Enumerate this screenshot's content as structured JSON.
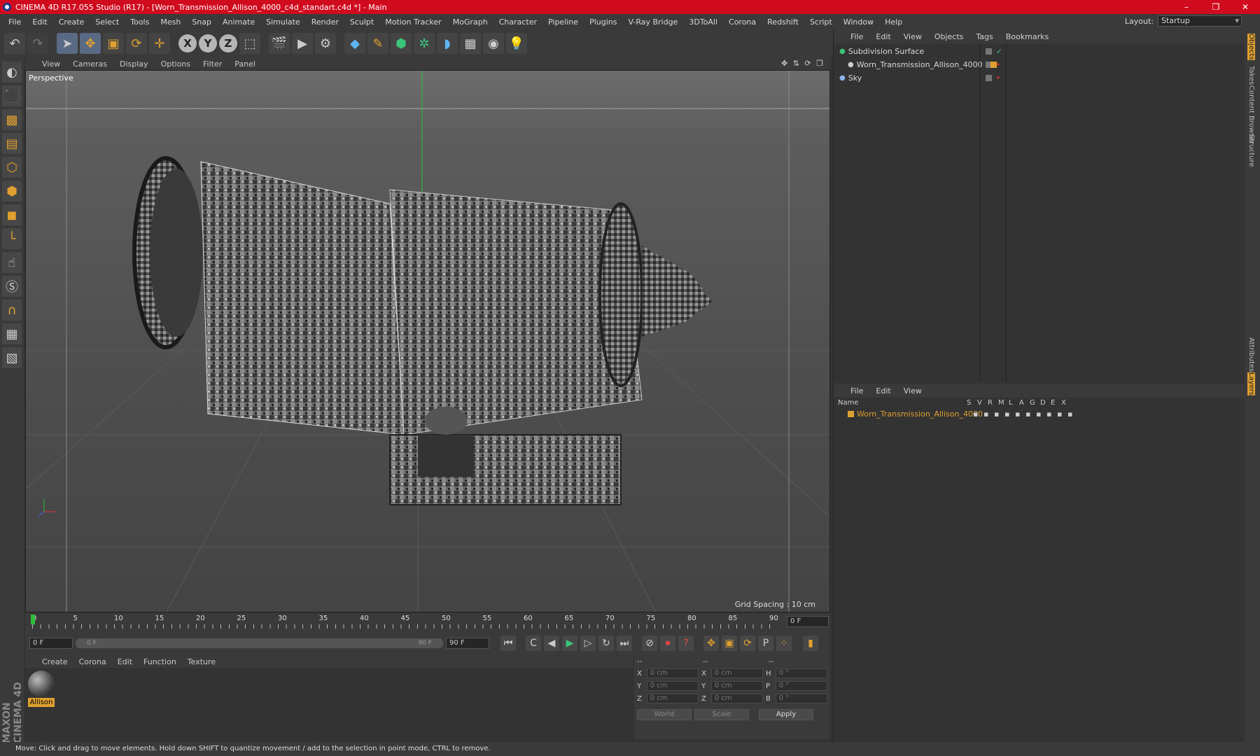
{
  "window": {
    "title": "CINEMA 4D R17.055 Studio (R17) - [Worn_Transmission_Allison_4000_c4d_standart.c4d *] - Main",
    "controls": [
      "–",
      "❐",
      "✕"
    ]
  },
  "menubar": [
    "File",
    "Edit",
    "Create",
    "Select",
    "Tools",
    "Mesh",
    "Snap",
    "Animate",
    "Simulate",
    "Render",
    "Sculpt",
    "Motion Tracker",
    "MoGraph",
    "Character",
    "Pipeline",
    "Plugins",
    "V-Ray Bridge",
    "3DToAll",
    "Corona",
    "Redshift",
    "Script",
    "Window",
    "Help"
  ],
  "layout": {
    "label": "Layout:",
    "value": "Startup"
  },
  "toolbar": {
    "axis_x": "X",
    "axis_y": "Y",
    "axis_z": "Z",
    "icons": [
      "undo-icon",
      "redo-icon",
      "select-icon",
      "move-icon",
      "scale-icon",
      "rotate-icon",
      "move-add-icon",
      "x-axis-icon",
      "y-axis-icon",
      "z-axis-icon",
      "coordinate-system-icon",
      "render-view-icon",
      "render-picture-viewer-icon",
      "edit-render-settings-icon",
      "cube-icon",
      "pen-icon",
      "subdivision-icon",
      "cloner-icon",
      "deformer-icon",
      "floor-icon",
      "camera-icon",
      "light-icon"
    ]
  },
  "viewport": {
    "menu": [
      "View",
      "Cameras",
      "Display",
      "Options",
      "Filter",
      "Panel"
    ],
    "label": "Perspective",
    "grid_spacing": "Grid Spacing : 10 cm"
  },
  "timeline": {
    "ticks": [
      "0",
      "5",
      "10",
      "15",
      "20",
      "25",
      "30",
      "35",
      "40",
      "45",
      "50",
      "55",
      "60",
      "65",
      "70",
      "75",
      "80",
      "85",
      "90"
    ],
    "current_frame": "0 F",
    "start_field": "0 F",
    "slider_start": "0 F",
    "slider_end": "90 F",
    "end_field": "90 F"
  },
  "material_manager": {
    "menu": [
      "Create",
      "Corona",
      "Edit",
      "Function",
      "Texture"
    ],
    "materials": [
      {
        "name": "Allison"
      }
    ]
  },
  "coordinates": {
    "header": [
      "--",
      "--",
      "--"
    ],
    "rows": [
      {
        "a": "X",
        "av": "0 cm",
        "b": "X",
        "bv": "0 cm",
        "c": "H",
        "cv": "0 °"
      },
      {
        "a": "Y",
        "av": "0 cm",
        "b": "Y",
        "bv": "0 cm",
        "c": "P",
        "cv": "0 °"
      },
      {
        "a": "Z",
        "av": "0 cm",
        "b": "Z",
        "bv": "0 cm",
        "c": "B",
        "cv": "0 °"
      }
    ],
    "mode_world": "World",
    "mode_scale": "Scale",
    "apply": "Apply"
  },
  "object_manager": {
    "menu": [
      "File",
      "Edit",
      "View",
      "Objects",
      "Tags",
      "Bookmarks"
    ],
    "objects": [
      {
        "name": "Subdivision Surface",
        "indent": 0
      },
      {
        "name": "Worn_Transmission_Allison_4000",
        "indent": 1
      },
      {
        "name": "Sky",
        "indent": 0
      }
    ]
  },
  "layer_manager": {
    "menu": [
      "File",
      "Edit",
      "View"
    ],
    "columns": [
      "Name",
      "S",
      "V",
      "R",
      "M",
      "L",
      "A",
      "G",
      "D",
      "E",
      "X"
    ],
    "layers": [
      {
        "name": "Worn_Transmission_Allison_4000",
        "color": "#e0a030"
      }
    ]
  },
  "right_tabs": [
    "Objects",
    "Takes",
    "Content Browser",
    "Structure",
    "Attributes",
    "Layers"
  ],
  "brand": "MAXON CINEMA 4D",
  "status": "Move: Click and drag to move elements. Hold down SHIFT to quantize movement / add to the selection in point mode, CTRL to remove.",
  "colors": {
    "accent": "#e0a030",
    "title_bar": "#d10b1e",
    "selection": "#5a6a85"
  }
}
